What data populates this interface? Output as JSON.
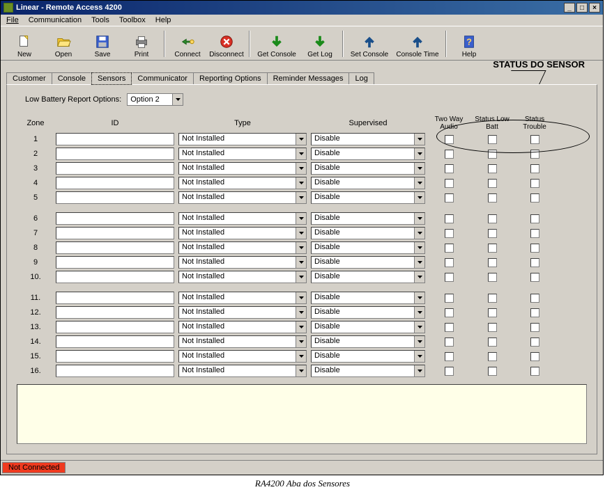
{
  "window": {
    "title": "Linear - Remote Access 4200",
    "min": "_",
    "max": "□",
    "close": "×"
  },
  "menu": {
    "file": "File",
    "communication": "Communication",
    "tools": "Tools",
    "toolbox": "Toolbox",
    "help": "Help"
  },
  "toolbar": {
    "new": "New",
    "open": "Open",
    "save": "Save",
    "print": "Print",
    "connect": "Connect",
    "disconnect": "Disconnect",
    "get_console": "Get Console",
    "get_log": "Get Log",
    "set_console": "Set Console",
    "console_time": "Console Time",
    "help": "Help"
  },
  "annotation": "STATUS DO SENSOR",
  "tabs": {
    "customer": "Customer",
    "console": "Console",
    "sensors": "Sensors",
    "communicator": "Communicator",
    "reporting": "Reporting Options",
    "reminder": "Reminder Messages",
    "log": "Log"
  },
  "panel": {
    "low_batt_label": "Low Battery Report Options:",
    "low_batt_value": "Option 2",
    "headers": {
      "zone": "Zone",
      "id": "ID",
      "type": "Type",
      "supervised": "Supervised",
      "two_way": "Two Way Audio",
      "low_batt": "Status Low Batt",
      "trouble": "Status Trouble"
    },
    "rows": [
      {
        "zone": "1",
        "id": "",
        "type": "Not Installed",
        "sup": "Disable"
      },
      {
        "zone": "2",
        "id": "",
        "type": "Not Installed",
        "sup": "Disable"
      },
      {
        "zone": "3",
        "id": "",
        "type": "Not Installed",
        "sup": "Disable"
      },
      {
        "zone": "4",
        "id": "",
        "type": "Not Installed",
        "sup": "Disable"
      },
      {
        "zone": "5",
        "id": "",
        "type": "Not Installed",
        "sup": "Disable"
      },
      {
        "zone": "6",
        "id": "",
        "type": "Not Installed",
        "sup": "Disable"
      },
      {
        "zone": "7",
        "id": "",
        "type": "Not Installed",
        "sup": "Disable"
      },
      {
        "zone": "8",
        "id": "",
        "type": "Not Installed",
        "sup": "Disable"
      },
      {
        "zone": "9",
        "id": "",
        "type": "Not Installed",
        "sup": "Disable"
      },
      {
        "zone": "10.",
        "id": "",
        "type": "Not Installed",
        "sup": "Disable"
      },
      {
        "zone": "11.",
        "id": "",
        "type": "Not Installed",
        "sup": "Disable"
      },
      {
        "zone": "12.",
        "id": "",
        "type": "Not Installed",
        "sup": "Disable"
      },
      {
        "zone": "13.",
        "id": "",
        "type": "Not Installed",
        "sup": "Disable"
      },
      {
        "zone": "14.",
        "id": "",
        "type": "Not Installed",
        "sup": "Disable"
      },
      {
        "zone": "15.",
        "id": "",
        "type": "Not Installed",
        "sup": "Disable"
      },
      {
        "zone": "16.",
        "id": "",
        "type": "Not Installed",
        "sup": "Disable"
      }
    ]
  },
  "status": {
    "text": "Not Connected"
  },
  "caption": "RA4200 Aba dos Sensores",
  "colors": {
    "statusbg": "#ef3a1f"
  }
}
